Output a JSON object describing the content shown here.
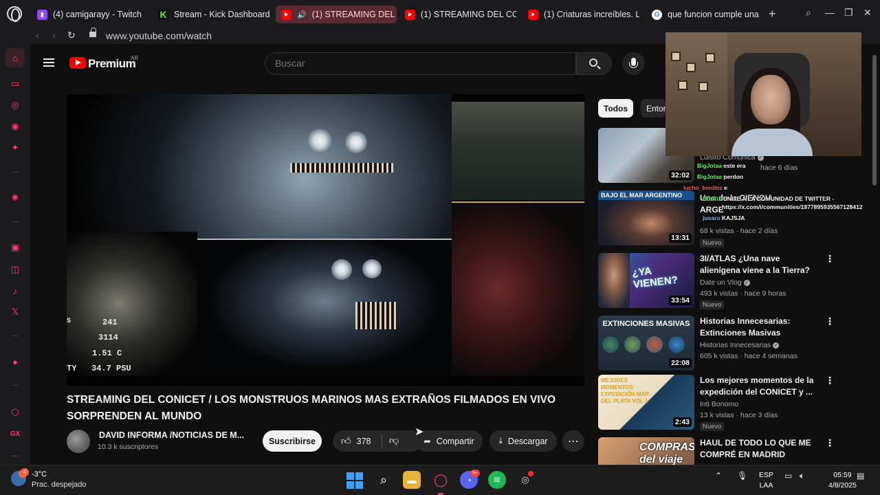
{
  "browser": {
    "tabs": [
      {
        "label": "(4) camigarayy - Twitch",
        "icon": "twitch-icon"
      },
      {
        "label": "Stream - Kick Dashboard",
        "icon": "kick-icon"
      },
      {
        "label": "(1) STREAMING DEL C",
        "icon": "youtube-icon"
      },
      {
        "label": "(1) STREAMING DEL CON",
        "icon": "youtube-icon"
      },
      {
        "label": "(1) Criaturas increíbles. L",
        "icon": "youtube-icon"
      },
      {
        "label": "que funcion cumple una",
        "icon": "google-icon"
      }
    ],
    "url": "www.youtube.com/watch"
  },
  "youtube": {
    "logo_text": "Premium",
    "country": "AR",
    "search_placeholder": "Buscar",
    "player_overlay": {
      "line1": "241",
      "line2": "3114",
      "line3": "1.51 C",
      "line4": "TY   34.7 PSU",
      "left_char": "S"
    },
    "video": {
      "title": "STREAMING DEL CONICET / LOS MONSTRUOS MARINOS MAS EXTRAÑOS FILMADOS EN VIVO SORPRENDEN AL MUNDO",
      "channel": "DAVID INFORMA /NOTICIAS DE M...",
      "subscribers": "10.3 k suscriptores",
      "subscribe_label": "Suscribirse",
      "likes": "378",
      "share_label": "Compartir",
      "download_label": "Descargar"
    },
    "chips": [
      "Todos",
      "Entor"
    ],
    "recommendations": [
      {
        "title": "",
        "channel": "Luisito Comunica",
        "meta": "hace 6 días",
        "duration": "32:02",
        "badge": "Nuevo"
      },
      {
        "title": "",
        "thumb_text": "BAJO EL MAR ARGENTINO",
        "meta": "68 k vistas · hace 2 días",
        "duration": "13:31",
        "badge": "Nuevo"
      },
      {
        "title": "3I/ATLAS ¿Una nave alienígena viene a la Tierra?",
        "thumb_text": "¿YA VIENEN?",
        "channel": "Date un Vlog",
        "meta": "493 k vistas · hace 9 horas",
        "duration": "33:54",
        "badge": "Nuevo"
      },
      {
        "title": "Historias Innecesarias: Extinciones Masivas",
        "thumb_text": "EXTINCIONES MASIVAS",
        "channel": "Historias Innecesarias",
        "meta": "605 k vistas · hace 4 semanas",
        "duration": "22:08",
        "badge": ""
      },
      {
        "title": "Los mejores momentos de la expedición del CONICET y ...",
        "thumb_text": "MEJORES MOMENTOS EXPEDICIÓN MAR DEL PLATA VOL 1",
        "channel": "Inti Bonomo",
        "meta": "13 k vistas · hace 3 días",
        "duration": "2:43",
        "badge": "Nuevo"
      },
      {
        "title": "HAUL DE TODO LO QUE ME COMPRÉ EN MADRID",
        "thumb_text": "COMPRAS del viaje",
        "channel": "",
        "meta": "",
        "duration": "",
        "badge": ""
      }
    ]
  },
  "chat": [
    {
      "user": "BigJotaa",
      "msg": "este era"
    },
    {
      "user": "BigJotaa",
      "msg": "perdon"
    },
    {
      "user": "lucho_benitez",
      "msg": "e"
    },
    {
      "user": "BotRix",
      "msg": "UNITE A LA COMUNIDAD DE TWITTER -"
    },
    {
      "user": "",
      "msg": "https://x.com/i/communities/1877895935567128412"
    },
    {
      "user": "jusaro",
      "msg": "KAJSJA"
    }
  ],
  "rec_partial": {
    "title_frag": "Uno de la CIENCIA",
    "title_frag2": "ARGE"
  },
  "taskbar": {
    "temp": "-3°C",
    "weather": "Prac. despejado",
    "notif_count": "4",
    "lang_line1": "ESP",
    "lang_line2": "LAA",
    "time": "05:59",
    "date": "4/8/2025",
    "discord_badge": "9+"
  },
  "colors": {
    "accent": "#ff3a6b",
    "youtube_red": "#ff0000",
    "background": "#0f0f0f"
  }
}
